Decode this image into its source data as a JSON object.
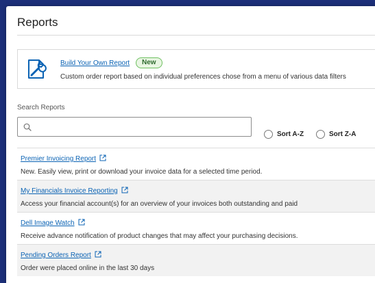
{
  "page": {
    "title": "Reports"
  },
  "build_report": {
    "link_label": "Build Your Own Report",
    "badge": "New",
    "description": "Custom order report based on individual preferences chose from a menu of various data filters",
    "icon": "report-wrench-icon"
  },
  "search": {
    "label": "Search Reports",
    "value": "",
    "placeholder": ""
  },
  "sort": {
    "az_label": "Sort A-Z",
    "za_label": "Sort Z-A",
    "selected": null
  },
  "reports": [
    {
      "title": "Premier Invoicing Report",
      "description": "New. Easily view, print or download your invoice data for a selected time period."
    },
    {
      "title": "My Financials Invoice Reporting",
      "description": "Access your financial account(s) for an overview of your invoices both outstanding and paid"
    },
    {
      "title": "Dell Image Watch",
      "description": "Receive advance notification of product changes that may affect your purchasing decisions."
    },
    {
      "title": "Pending Orders Report",
      "description": "Order were placed online in the last 30 days"
    }
  ],
  "colors": {
    "background": "#1c2f79",
    "link": "#0b63b4",
    "badge_border": "#6dbf5f",
    "badge_bg": "#e9f6e3"
  }
}
